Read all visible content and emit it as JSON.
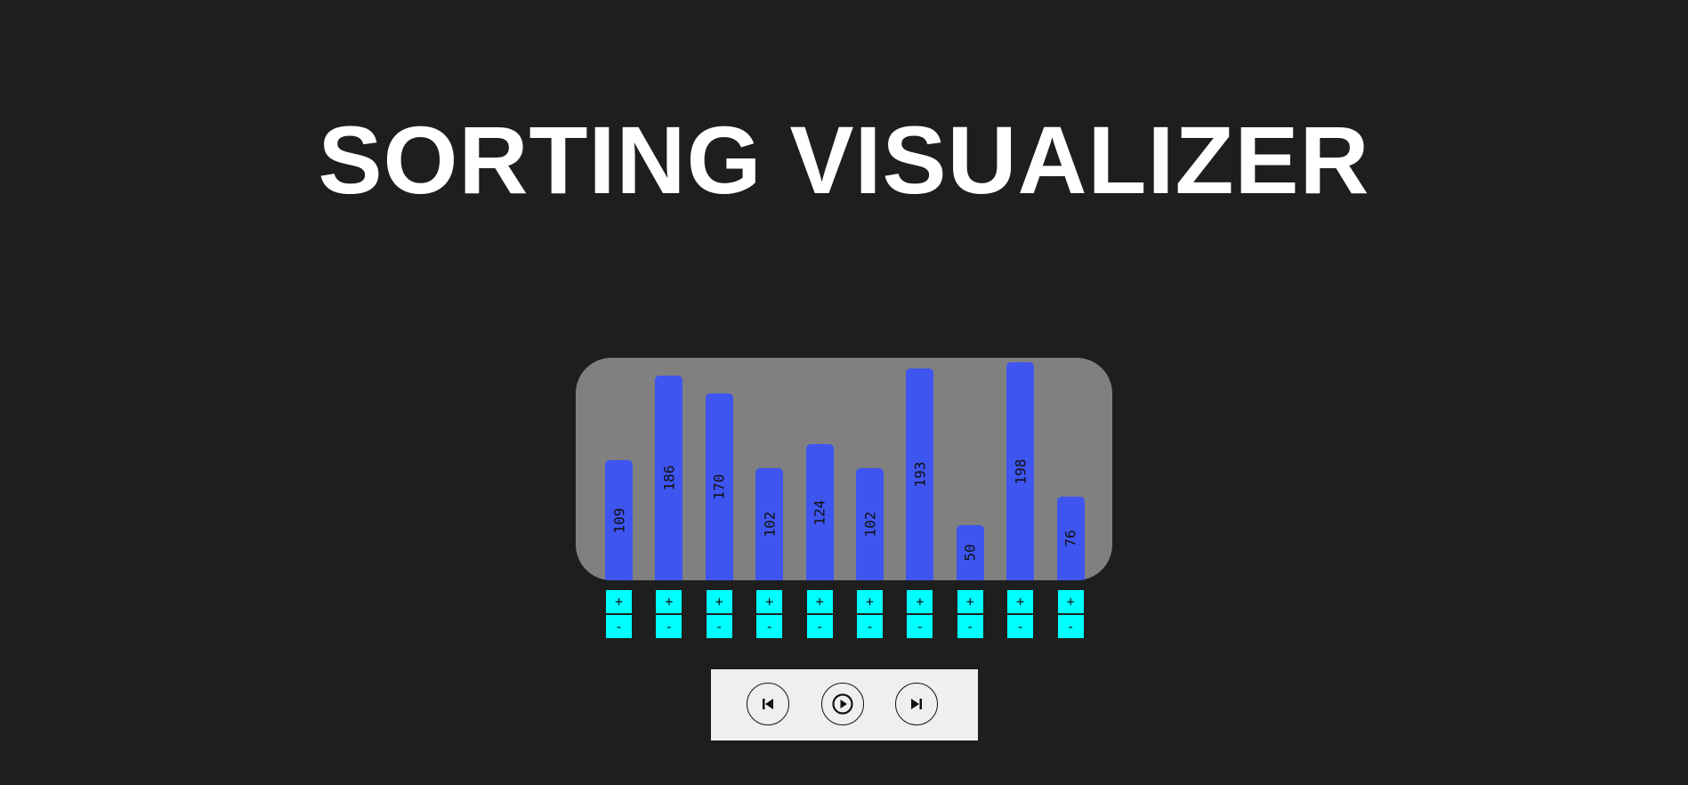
{
  "header": {
    "title": "SORTING VISUALIZER"
  },
  "colors": {
    "background": "#1e1e1e",
    "panel": "#808080",
    "bar": "#3e55ef",
    "stepper": "#00ffff",
    "controls": "#efefef"
  },
  "chart_data": {
    "type": "bar",
    "values": [
      109,
      186,
      170,
      102,
      124,
      102,
      193,
      50,
      198,
      76
    ],
    "ylim": [
      0,
      200
    ]
  },
  "steppers": {
    "plus_label": "+",
    "minus_label": "-"
  },
  "controls": {
    "prev_icon": "skip-previous-icon",
    "play_icon": "play-circle-icon",
    "next_icon": "skip-next-icon"
  }
}
